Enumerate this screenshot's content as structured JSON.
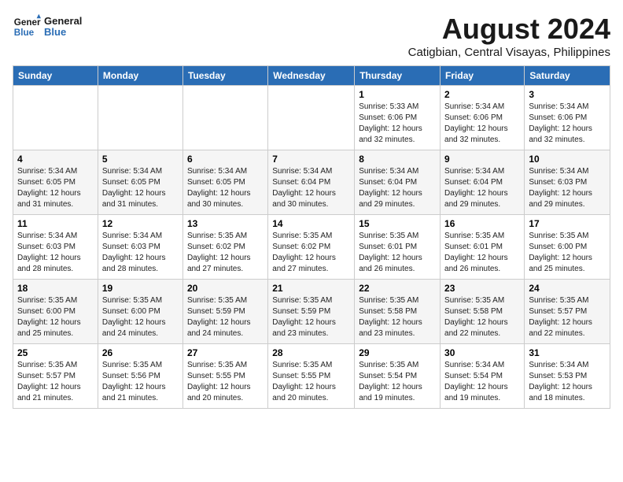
{
  "header": {
    "logo_line1": "General",
    "logo_line2": "Blue",
    "main_title": "August 2024",
    "subtitle": "Catigbian, Central Visayas, Philippines"
  },
  "days_of_week": [
    "Sunday",
    "Monday",
    "Tuesday",
    "Wednesday",
    "Thursday",
    "Friday",
    "Saturday"
  ],
  "weeks": [
    [
      {
        "day": "",
        "info": ""
      },
      {
        "day": "",
        "info": ""
      },
      {
        "day": "",
        "info": ""
      },
      {
        "day": "",
        "info": ""
      },
      {
        "day": "1",
        "info": "Sunrise: 5:33 AM\nSunset: 6:06 PM\nDaylight: 12 hours\nand 32 minutes."
      },
      {
        "day": "2",
        "info": "Sunrise: 5:34 AM\nSunset: 6:06 PM\nDaylight: 12 hours\nand 32 minutes."
      },
      {
        "day": "3",
        "info": "Sunrise: 5:34 AM\nSunset: 6:06 PM\nDaylight: 12 hours\nand 32 minutes."
      }
    ],
    [
      {
        "day": "4",
        "info": "Sunrise: 5:34 AM\nSunset: 6:05 PM\nDaylight: 12 hours\nand 31 minutes."
      },
      {
        "day": "5",
        "info": "Sunrise: 5:34 AM\nSunset: 6:05 PM\nDaylight: 12 hours\nand 31 minutes."
      },
      {
        "day": "6",
        "info": "Sunrise: 5:34 AM\nSunset: 6:05 PM\nDaylight: 12 hours\nand 30 minutes."
      },
      {
        "day": "7",
        "info": "Sunrise: 5:34 AM\nSunset: 6:04 PM\nDaylight: 12 hours\nand 30 minutes."
      },
      {
        "day": "8",
        "info": "Sunrise: 5:34 AM\nSunset: 6:04 PM\nDaylight: 12 hours\nand 29 minutes."
      },
      {
        "day": "9",
        "info": "Sunrise: 5:34 AM\nSunset: 6:04 PM\nDaylight: 12 hours\nand 29 minutes."
      },
      {
        "day": "10",
        "info": "Sunrise: 5:34 AM\nSunset: 6:03 PM\nDaylight: 12 hours\nand 29 minutes."
      }
    ],
    [
      {
        "day": "11",
        "info": "Sunrise: 5:34 AM\nSunset: 6:03 PM\nDaylight: 12 hours\nand 28 minutes."
      },
      {
        "day": "12",
        "info": "Sunrise: 5:34 AM\nSunset: 6:03 PM\nDaylight: 12 hours\nand 28 minutes."
      },
      {
        "day": "13",
        "info": "Sunrise: 5:35 AM\nSunset: 6:02 PM\nDaylight: 12 hours\nand 27 minutes."
      },
      {
        "day": "14",
        "info": "Sunrise: 5:35 AM\nSunset: 6:02 PM\nDaylight: 12 hours\nand 27 minutes."
      },
      {
        "day": "15",
        "info": "Sunrise: 5:35 AM\nSunset: 6:01 PM\nDaylight: 12 hours\nand 26 minutes."
      },
      {
        "day": "16",
        "info": "Sunrise: 5:35 AM\nSunset: 6:01 PM\nDaylight: 12 hours\nand 26 minutes."
      },
      {
        "day": "17",
        "info": "Sunrise: 5:35 AM\nSunset: 6:00 PM\nDaylight: 12 hours\nand 25 minutes."
      }
    ],
    [
      {
        "day": "18",
        "info": "Sunrise: 5:35 AM\nSunset: 6:00 PM\nDaylight: 12 hours\nand 25 minutes."
      },
      {
        "day": "19",
        "info": "Sunrise: 5:35 AM\nSunset: 6:00 PM\nDaylight: 12 hours\nand 24 minutes."
      },
      {
        "day": "20",
        "info": "Sunrise: 5:35 AM\nSunset: 5:59 PM\nDaylight: 12 hours\nand 24 minutes."
      },
      {
        "day": "21",
        "info": "Sunrise: 5:35 AM\nSunset: 5:59 PM\nDaylight: 12 hours\nand 23 minutes."
      },
      {
        "day": "22",
        "info": "Sunrise: 5:35 AM\nSunset: 5:58 PM\nDaylight: 12 hours\nand 23 minutes."
      },
      {
        "day": "23",
        "info": "Sunrise: 5:35 AM\nSunset: 5:58 PM\nDaylight: 12 hours\nand 22 minutes."
      },
      {
        "day": "24",
        "info": "Sunrise: 5:35 AM\nSunset: 5:57 PM\nDaylight: 12 hours\nand 22 minutes."
      }
    ],
    [
      {
        "day": "25",
        "info": "Sunrise: 5:35 AM\nSunset: 5:57 PM\nDaylight: 12 hours\nand 21 minutes."
      },
      {
        "day": "26",
        "info": "Sunrise: 5:35 AM\nSunset: 5:56 PM\nDaylight: 12 hours\nand 21 minutes."
      },
      {
        "day": "27",
        "info": "Sunrise: 5:35 AM\nSunset: 5:55 PM\nDaylight: 12 hours\nand 20 minutes."
      },
      {
        "day": "28",
        "info": "Sunrise: 5:35 AM\nSunset: 5:55 PM\nDaylight: 12 hours\nand 20 minutes."
      },
      {
        "day": "29",
        "info": "Sunrise: 5:35 AM\nSunset: 5:54 PM\nDaylight: 12 hours\nand 19 minutes."
      },
      {
        "day": "30",
        "info": "Sunrise: 5:34 AM\nSunset: 5:54 PM\nDaylight: 12 hours\nand 19 minutes."
      },
      {
        "day": "31",
        "info": "Sunrise: 5:34 AM\nSunset: 5:53 PM\nDaylight: 12 hours\nand 18 minutes."
      }
    ]
  ]
}
